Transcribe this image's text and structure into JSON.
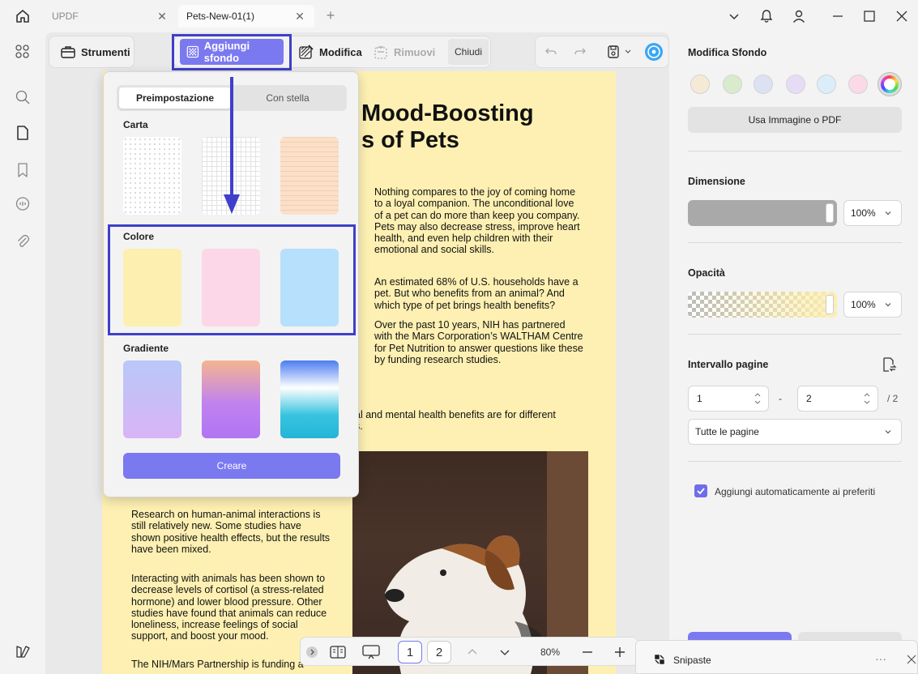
{
  "titlebar": {
    "tabs": [
      {
        "label": "UPDF",
        "active": false
      },
      {
        "label": "Pets-New-01(1)",
        "active": true
      }
    ]
  },
  "toolbar": {
    "strumenti": "Strumenti",
    "aggiungi_sfondo": "Aggiungi sfondo",
    "modifica": "Modifica",
    "rimuovi": "Rimuovi",
    "chiudi": "Chiudi"
  },
  "popup": {
    "tabs": [
      "Preimpostazione",
      "Con stella"
    ],
    "sections": {
      "carta": "Carta",
      "colore": "Colore",
      "gradiente": "Gradiente"
    },
    "create_label": "Creare",
    "colors": [
      "#fcefb0",
      "#fcd7e7",
      "#b6e0fb"
    ]
  },
  "document": {
    "title_line1": "Mood-Boosting",
    "title_line2": "s of Pets",
    "para1": "Nothing compares to the joy of coming home to a loyal companion. The unconditional love of a pet can do more than keep you company. Pets may also decrease stress, improve heart health,  and  even  help children  with  their emotional and social skills.",
    "para2": "An estimated 68% of U.S. households have a pet. But who benefits from an animal? And which type of pet brings health benefits?",
    "para3": "Over  the  past  10  years,  NIH  has partnered with the Mars Corporation’s WALTHAM Centre for  Pet  Nutrition  to answer  questions  like these by funding research studies.",
    "para4a": "al and mental health benefits are for different",
    "para4b": "s.",
    "para5": "Research  on  human-animal  interactions is still relatively new. Some studies have shown  positive  health  effects,  but  the results have been mixed.",
    "para6": "Interacting with animals has been shown to decrease levels of cortisol (a stress-related hormone) and lower blood pressure. Other studies have found that animals can reduce loneliness,  increase  feelings  of social support, and boost your mood.",
    "para7": "The  NIH/Mars  Partnership  is  funding  a"
  },
  "bottom_bar": {
    "pages": [
      "1",
      "2"
    ],
    "zoom": "80%"
  },
  "right_panel": {
    "title": "Modifica Sfondo",
    "circle_colors": [
      "#f5ead5",
      "#d8ebcc",
      "#dde1f4",
      "#e7dcf8",
      "#d9eef8",
      "#fbd9e7"
    ],
    "use_image_label": "Usa Immagine o PDF",
    "dimensione": "Dimensione",
    "dimensione_value": "100%",
    "opacita": "Opacità",
    "opacita_value": "100%",
    "intervallo": "Intervallo pagine",
    "from_page": "1",
    "separator": "-",
    "to_page": "2",
    "total": "/ 2",
    "page_select": "Tutte le pagine",
    "auto_fav": "Aggiungi automaticamente ai preferiti"
  },
  "snipaste": {
    "label": "Snipaste",
    "menu": "···"
  }
}
